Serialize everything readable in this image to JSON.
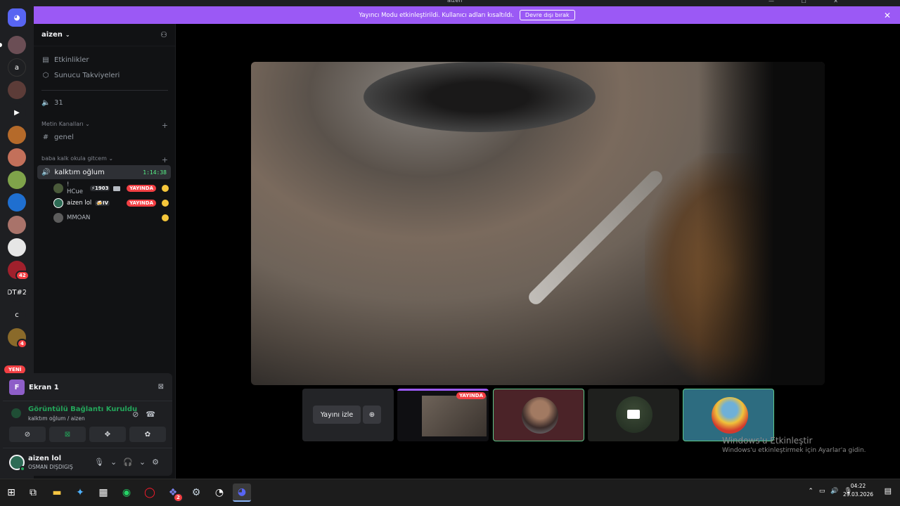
{
  "window": {
    "title": "aizen"
  },
  "banner": {
    "text": "Yayıncı Modu etkinleştirildi. Kullanıcı adları kısaltıldı.",
    "button": "Devre dışı bırak",
    "close": "✕",
    "color": "#9b59f5"
  },
  "servers": {
    "a_label": "a",
    "dt_label": "DT#2",
    "c_label": "c",
    "badge_42": "42",
    "badge_4": "4",
    "new_label": "YENİ"
  },
  "sidebar": {
    "server_name": "aizen",
    "events": "Etkinlikler",
    "boosts": "Sunucu Takviyeleri",
    "voice_31": "31",
    "text_category": "Metin Kanalları",
    "text_channel": "genel",
    "voice_category": "baba kalk okula gitcem",
    "voice_channel": "kalktım oğlum",
    "voice_time": "1:14:38",
    "users": [
      {
        "name": "! HCue",
        "tag": "⚡1903",
        "live": "YAYINDA"
      },
      {
        "name": "aizen lol",
        "tag": "🍻IV",
        "live": "YAYINDA"
      },
      {
        "name": "MMOAN",
        "tag": "",
        "live": ""
      }
    ]
  },
  "screen_panel": {
    "icon_letter": "F",
    "title": "Ekran 1",
    "conn_title": "Görüntülü Bağlantı Kuruldu",
    "conn_sub": "kalktım oğlum / aizen"
  },
  "user": {
    "name": "aizen lol",
    "status": "OSMAN DIŞDIGIŞ"
  },
  "stage": {
    "watch_label": "Yayını izle",
    "live_label": "YAYINDA"
  },
  "activation": {
    "title": "Windows'u Etkinleştir",
    "subtitle": "Windows'u etkinleştirmek için Ayarlar'a gidin."
  },
  "taskbar": {
    "time": "04:22",
    "date": "29.03.2026",
    "teams_badge": "2"
  }
}
